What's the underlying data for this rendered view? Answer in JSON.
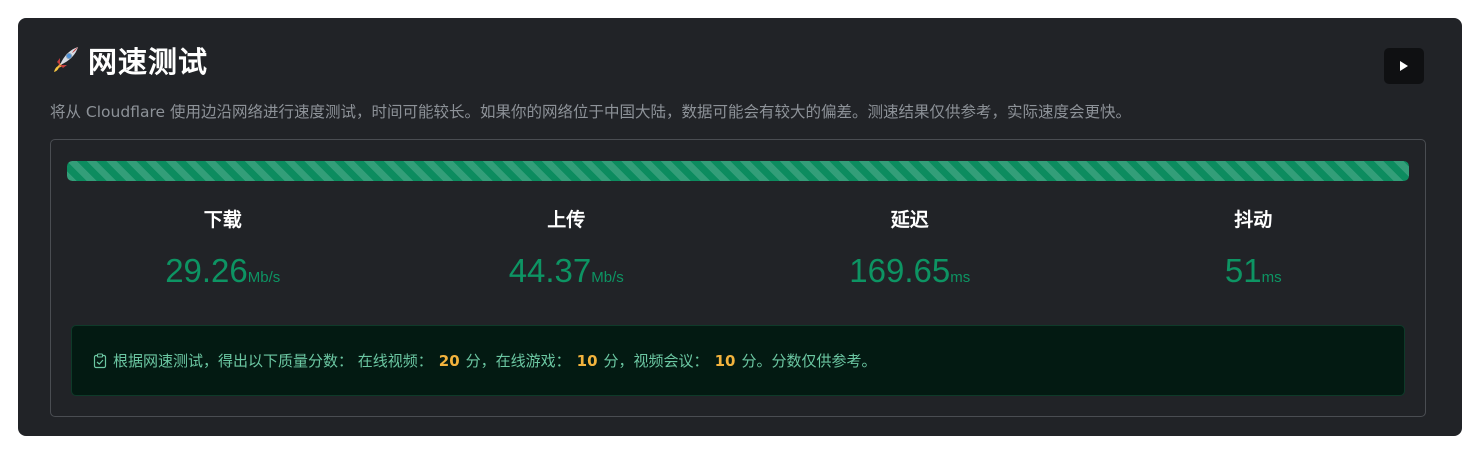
{
  "header": {
    "title": "网速测试",
    "rocket_icon": "rocket-icon",
    "run_button_icon": "play-icon"
  },
  "description": "将从 Cloudflare 使用边沿网络进行速度测试，时间可能较长。如果你的网络位于中国大陆，数据可能会有较大的偏差。测速结果仅供参考，实际速度会更快。",
  "progress": {
    "fraction": 1.0
  },
  "metrics": [
    {
      "label": "下载",
      "value": "29.26",
      "unit": "Mb/s"
    },
    {
      "label": "上传",
      "value": "44.37",
      "unit": "Mb/s"
    },
    {
      "label": "延迟",
      "value": "169.65",
      "unit": "ms"
    },
    {
      "label": "抖动",
      "value": "51",
      "unit": "ms"
    }
  ],
  "result": {
    "icon": "clipboard-icon",
    "prefix": "根据网速测试，得出以下质量分数： 在线视频：",
    "video_score": "20",
    "mid1": "分，在线游戏：",
    "game_score": "10",
    "mid2": "分，视频会议：",
    "conference_score": "10",
    "suffix": "分。分数仅供参考。"
  },
  "colors": {
    "card_bg": "#212327",
    "accent_green": "#0d9463",
    "progress_green": "#0c8c5f",
    "score_yellow": "#f2b33d",
    "result_bg": "#031a12",
    "result_text": "#6bc7a2"
  }
}
